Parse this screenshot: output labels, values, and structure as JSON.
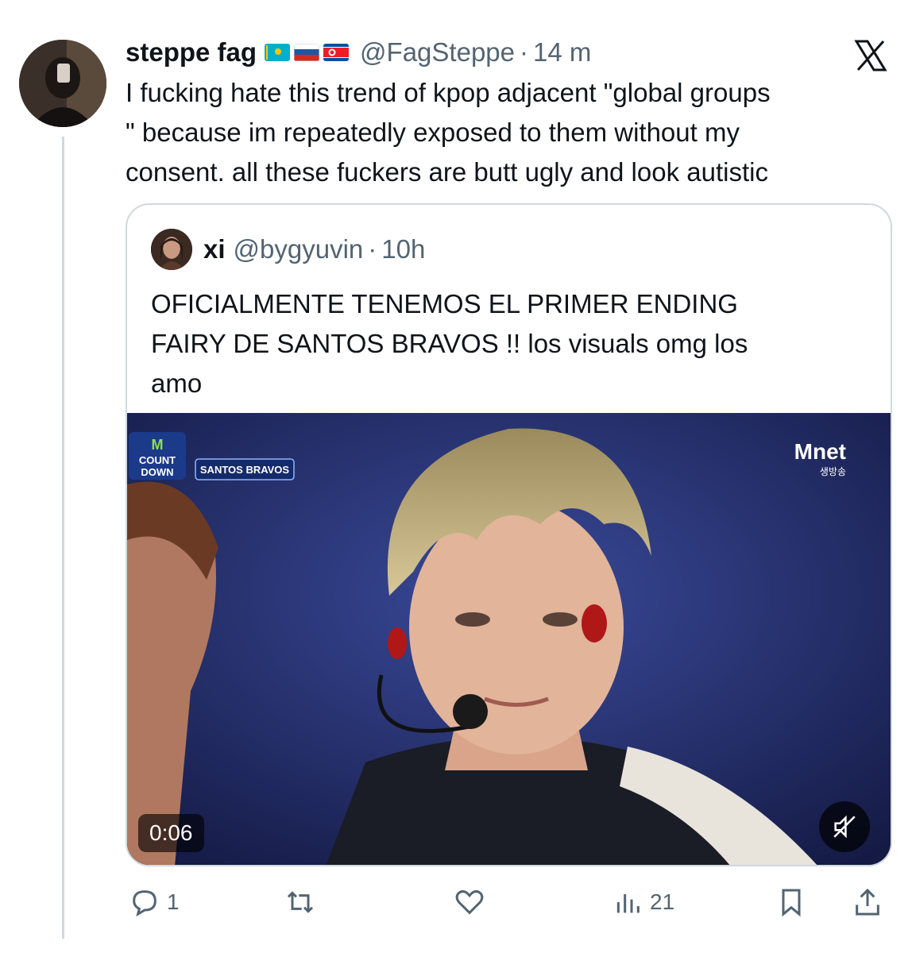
{
  "tweet": {
    "author_name": "steppe fag",
    "flags": [
      "kazakhstan-flag",
      "russia-flag",
      "north-korea-flag"
    ],
    "handle": "@FagSteppe",
    "separator": "·",
    "time": "14 m",
    "text": "I fucking hate this trend of kpop adjacent \"global groups\n\" because im repeatedly exposed to them without my\nconsent. all these fuckers are butt ugly and look autistic"
  },
  "quote": {
    "author_name": "xi",
    "handle": "@bygyuvin",
    "separator": "·",
    "time": "10h",
    "text": "OFICIALMENTE TENEMOS EL PRIMER ENDING\nFAIRY DE SANTOS BRAVOS !! los visuals omg los\namo",
    "video": {
      "duration": "0:06",
      "overlay_banner": "SANTOS BRAVOS",
      "show_logo_lines": [
        "M",
        "COUNT",
        "DOWN"
      ],
      "channel_logo": "net",
      "channel_sub": "생방송"
    }
  },
  "actions": {
    "replies": "1",
    "views": "21"
  },
  "colors": {
    "text": "#0f1419",
    "muted": "#536471",
    "border": "#cfd9de"
  }
}
